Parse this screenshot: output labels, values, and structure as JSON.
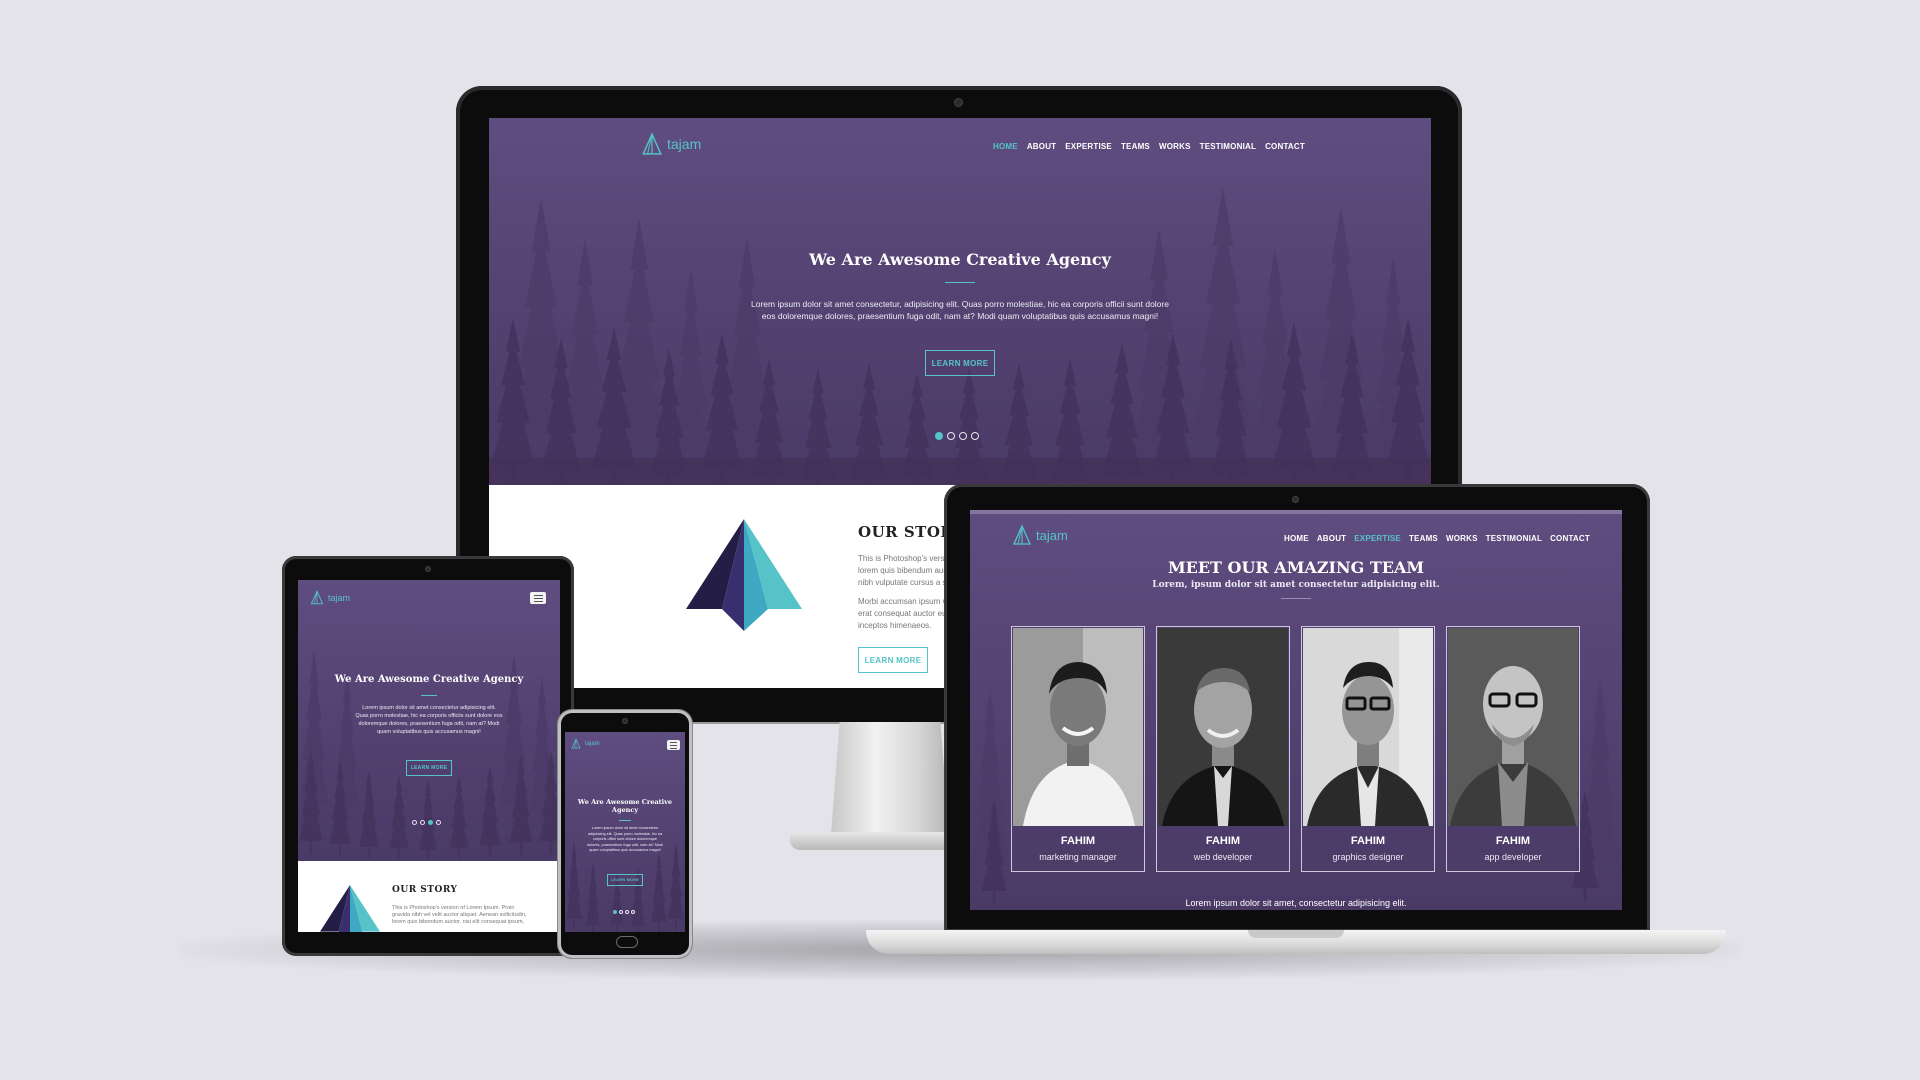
{
  "site": {
    "logo_text": "tajam",
    "nav": [
      {
        "label": "HOME"
      },
      {
        "label": "ABOUT"
      },
      {
        "label": "EXPERTISE"
      },
      {
        "label": "TEAMS"
      },
      {
        "label": "WORKS"
      },
      {
        "label": "TESTIMONIAL"
      },
      {
        "label": "CONTACT"
      }
    ]
  },
  "monitor": {
    "active_nav": "HOME",
    "hero": {
      "title": "We Are Awesome Creative Agency",
      "text_line1": "Lorem ipsum dolor sit amet consectetur, adipisicing elit. Quas porro molestiae, hic ea corporis officii sunt dolore",
      "text_line2": "eos doloremque dolores, praesentium fuga odit, nam at? Modi quam voluptatibus quis accusamus magni!",
      "button": "LEARN MORE"
    },
    "carousel": {
      "total": 4,
      "active_index": 0
    },
    "story": {
      "title": "OUR STORY",
      "line1": "This is Photoshop's version of Lorem Ipsum.",
      "line2": "lorem quis bibendum auctor, nisi elit consequat",
      "line3": "nibh vulputate cursus a sit amet mauris.",
      "line4": "Morbi accumsan ipsum velit. Nam nec tellus a odio",
      "line5": "erat consequat auctor eu in elit. Class aptent",
      "line6": "inceptos himenaeos.",
      "button": "LEARN MORE"
    }
  },
  "laptop": {
    "active_nav": "EXPERTISE",
    "team": {
      "title": "MEET OUR AMAZING TEAM",
      "subtitle": "Lorem, ipsum dolor sit amet consectetur adipisicing elit.",
      "members": [
        {
          "name": "FAHIM",
          "role": "marketing manager"
        },
        {
          "name": "FAHIM",
          "role": "web developer"
        },
        {
          "name": "FAHIM",
          "role": "graphics designer"
        },
        {
          "name": "FAHIM",
          "role": "app developer"
        }
      ],
      "footer_text": "Lorem ipsum dolor sit amet, consectetur adipisicing elit."
    }
  },
  "tablet": {
    "hero": {
      "title": "We Are Awesome Creative Agency",
      "line1": "Lorem ipsum dolor sit amet consectetur adipisicing elit.",
      "line2": "Quas porro molestiae, hic ea corporis officiis sunt dolore eos",
      "line3": "doloremque dolores, praesentium fuga odit, nam at? Modi",
      "line4": "quam voluptatibus quis accusamus magni!",
      "button": "LEARN MORE"
    },
    "carousel": {
      "total": 4,
      "active_index": 2
    },
    "story": {
      "title": "OUR STORY",
      "line1": "This is Photoshop's version of Lorem Ipsum. Proin",
      "line2": "gravida nibh vel velit auctor aliquet. Aenean sollicitudin,",
      "line3": "lorem quis bibendum auctor, nisi elit consequat ipsum,"
    }
  },
  "phone": {
    "hero": {
      "title_line1": "We Are Awesome Creative",
      "title_line2": "Agency",
      "line1": "Lorem ipsum dolor sit amet consectetur",
      "line2": "adipisicing elit. Quas porro molestiae, hic ea",
      "line3": "corporis officii sunt dolore doloremque",
      "line4": "dolores, praesentium fuga odit, nam at? Modi",
      "line5": "quam voluptatibus quis accusamus magni!",
      "button": "LEARN MORE"
    },
    "carousel": {
      "total": 4,
      "active_index": 0
    }
  },
  "colors": {
    "accent": "#55c3c8",
    "hero_purple": "#554373",
    "device_black": "#0c0c0d",
    "backdrop": "#e4e3ea"
  },
  "icons": {
    "logo": "pyramid-logo-icon",
    "menu": "hamburger-menu-icon",
    "story_art": "pyramid-illustration"
  }
}
